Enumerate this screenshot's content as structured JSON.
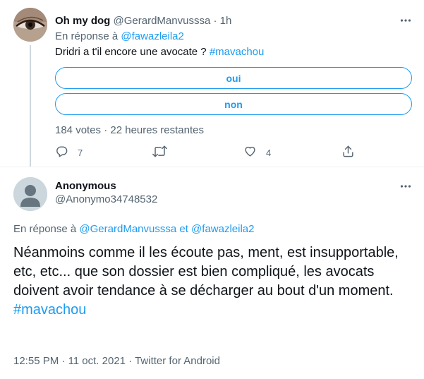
{
  "poll_tweet": {
    "display_name": "Oh my dog",
    "handle": "@GerardManvusssa",
    "separator": "·",
    "time": "1h",
    "reply_prefix": "En réponse à",
    "reply_mention": "@fawazleila2",
    "text": "Dridri a t'il encore une avocate ? ",
    "hashtag": "#mavachou",
    "poll": {
      "options": [
        "oui",
        "non"
      ],
      "votes": "184 votes",
      "separator": "·",
      "remaining": "22 heures restantes"
    },
    "actions": {
      "reply_count": "7",
      "retweet_count": "",
      "like_count": "4"
    }
  },
  "main_tweet": {
    "display_name": "Anonymous",
    "handle": "@Anonymo34748532",
    "reply_prefix": "En réponse à",
    "reply_mentions": [
      "@GerardManvusssa",
      "@fawazleila2"
    ],
    "reply_conjunction": "et",
    "text": "Néanmoins comme il les écoute pas, ment, est insupportable, etc, etc... que son dossier est bien compliqué, les avocats doivent avoir tendance à se décharger au bout d'un moment.",
    "hashtag": "#mavachou",
    "timestamp": "12:55 PM",
    "separator1": "·",
    "date": "11 oct. 2021",
    "separator2": "·",
    "source": "Twitter for Android"
  },
  "colors": {
    "link": "#1d9bf0",
    "secondary_text": "#536471",
    "primary_text": "#0f1419",
    "divider": "#eff3f4"
  },
  "icons": [
    "more-icon",
    "reply-icon",
    "retweet-icon",
    "like-icon",
    "share-icon",
    "default-avatar-icon"
  ]
}
